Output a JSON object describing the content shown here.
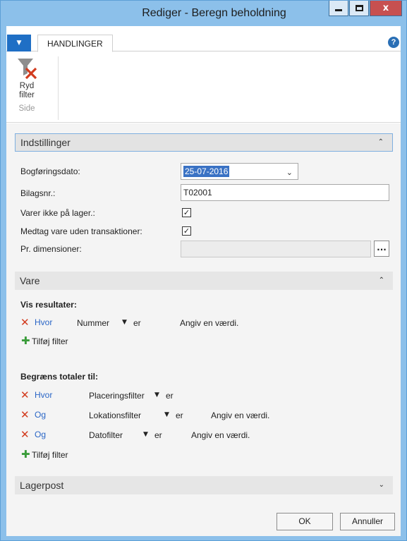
{
  "window": {
    "title": "Rediger - Beregn beholdning",
    "close_glyph": "x"
  },
  "ribbon": {
    "tab": "HANDLINGER",
    "help_glyph": "?",
    "clear_filter_label_1": "Ryd",
    "clear_filter_label_2": "filter",
    "group_name": "Side"
  },
  "sections": {
    "settings": "Indstillinger",
    "item": "Vare",
    "ledger": "Lagerpost"
  },
  "settings": {
    "posting_date_label": "Bogføringsdato:",
    "posting_date_value": "25-07-2016",
    "doc_no_label": "Bilagsnr.:",
    "doc_no_value": "T02001",
    "items_not_on_inventory_label": "Varer ikke på lager.:",
    "include_no_transactions_label": "Medtag vare uden transaktioner:",
    "by_dimensions_label": "Pr. dimensioner:",
    "dots": "..."
  },
  "item_filters": {
    "show_results": "Vis resultater:",
    "rows": [
      {
        "conj": "Hvor",
        "field": "Nummer",
        "op": "er",
        "value": "Angiv en værdi."
      }
    ],
    "add_filter": "Tilføj filter"
  },
  "total_filters": {
    "limit_totals": "Begræns totaler til:",
    "rows": [
      {
        "conj": "Hvor",
        "field": "Placeringsfilter",
        "op": "er",
        "value": ""
      },
      {
        "conj": "Og",
        "field": "Lokationsfilter",
        "op": "er",
        "value": "Angiv en værdi."
      },
      {
        "conj": "Og",
        "field": "Datofilter",
        "op": "er",
        "value": "Angiv en værdi."
      }
    ],
    "add_filter": "Tilføj filter"
  },
  "buttons": {
    "ok": "OK",
    "cancel": "Annuller"
  },
  "colors": {
    "accent": "#1f6fc5",
    "titlebar": "#8cc0ea",
    "close": "#c75050",
    "remove": "#d23b1e",
    "add": "#3a9c3a"
  }
}
